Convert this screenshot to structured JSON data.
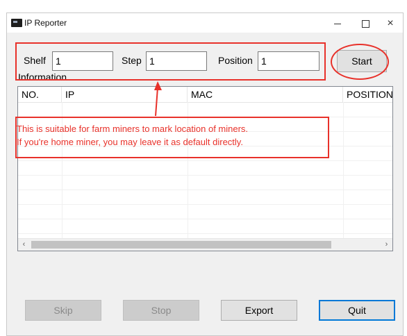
{
  "window": {
    "title": "IP Reporter",
    "controls": {
      "minimize": "minimize",
      "maximize": "maximize",
      "close": "×"
    }
  },
  "fields": {
    "shelf": {
      "label": "Shelf",
      "value": "1"
    },
    "step": {
      "label": "Step",
      "value": "1"
    },
    "position": {
      "label": "Position",
      "value": "1"
    }
  },
  "buttons": {
    "start": "Start",
    "skip": "Skip",
    "stop": "Stop",
    "export": "Export",
    "quit": "Quit"
  },
  "information": {
    "label": "Information",
    "columns": [
      "NO.",
      "IP",
      "MAC",
      "POSITION"
    ],
    "rows": []
  },
  "scrollbar": {
    "left_arrow": "‹",
    "right_arrow": "›"
  },
  "annotation": {
    "color": "#e8312a",
    "lines": [
      "This is suitable for farm miners to mark location of miners.",
      "If you're home miner, you may leave it as default directly."
    ]
  }
}
